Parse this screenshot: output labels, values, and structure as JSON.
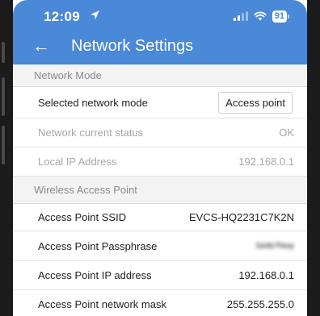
{
  "status_bar": {
    "time": "12:09",
    "battery": "91"
  },
  "header": {
    "title": "Network Settings"
  },
  "sections": {
    "network_mode": {
      "header": "Network Mode",
      "selected_mode_label": "Selected network mode",
      "selected_mode_value": "Access point",
      "current_status_label": "Network current status",
      "current_status_value": "OK",
      "local_ip_label": "Local IP Address",
      "local_ip_value": "192.168.0.1"
    },
    "wireless_ap": {
      "header": "Wireless Access Point",
      "ssid_label": "Access Point SSID",
      "ssid_value": "EVCS-HQ2231C7K2N",
      "passphrase_label": "Access Point Passphrase",
      "passphrase_value": "5d4b7f4ep",
      "ip_label": "Access Point IP address",
      "ip_value": "192.168.0.1",
      "mask_label": "Access Point network mask",
      "mask_value": "255.255.255.0"
    }
  },
  "colors": {
    "appbar": "#4a88d8",
    "section_bg": "#f3f3f4"
  }
}
